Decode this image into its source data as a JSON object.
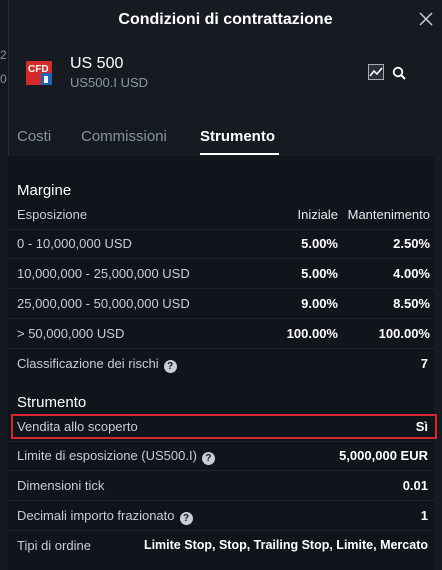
{
  "dialog": {
    "title": "Condizioni di contrattazione"
  },
  "instrument": {
    "name": "US 500",
    "subtitle": "US500.I USD",
    "logo_text": "CFD"
  },
  "tabs": [
    {
      "label": "Costi",
      "active": false
    },
    {
      "label": "Commissioni",
      "active": false
    },
    {
      "label": "Strumento",
      "active": true
    }
  ],
  "margin": {
    "title": "Margine",
    "header": {
      "col1": "Esposizione",
      "col2": "Iniziale",
      "col3": "Mantenimento"
    },
    "rows": [
      {
        "exposure": "0 - 10,000,000 USD",
        "initial": "5.00%",
        "maintenance": "2.50%"
      },
      {
        "exposure": "10,000,000 - 25,000,000 USD",
        "initial": "5.00%",
        "maintenance": "4.00%"
      },
      {
        "exposure": "25,000,000 - 50,000,000 USD",
        "initial": "9.00%",
        "maintenance": "8.50%"
      },
      {
        "exposure": "> 50,000,000 USD",
        "initial": "100.00%",
        "maintenance": "100.00%"
      }
    ],
    "risk_label": "Classificazione dei rischi",
    "risk_value": "7"
  },
  "instrument_section": {
    "title": "Strumento",
    "rows": [
      {
        "label": "Vendita allo scoperto",
        "value": "Sì"
      },
      {
        "label": "Limite di esposizione (US500.I)",
        "value": "5,000,000 EUR"
      },
      {
        "label": "Dimensioni tick",
        "value": "0.01"
      },
      {
        "label": "Decimali importo frazionato",
        "value": "1"
      },
      {
        "label": "Tipi di ordine",
        "value": "Limite Stop, Stop, Trailing Stop, Limite, Mercato"
      }
    ]
  },
  "background_strip": [
    "2",
    "0"
  ],
  "colors": {
    "highlight": "#d9282d",
    "logo_red": "#d42a2a",
    "logo_blue": "#1e63b5"
  }
}
